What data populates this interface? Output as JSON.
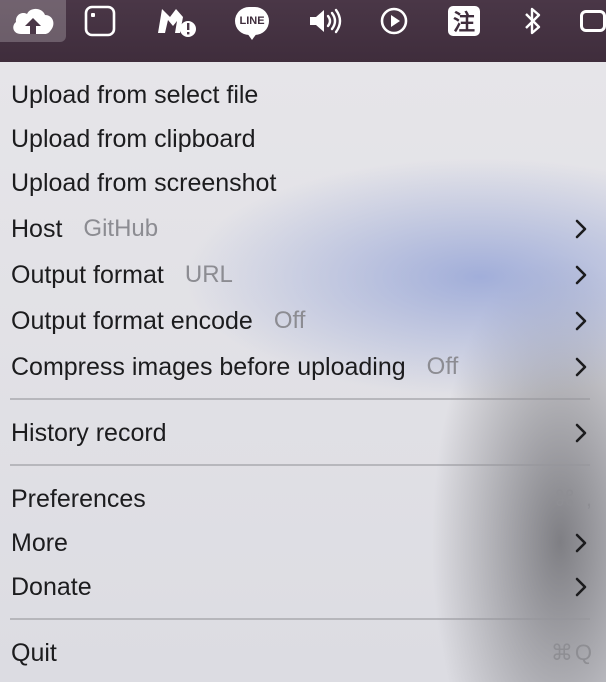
{
  "menubar": {
    "icons": [
      "cloud-upload-icon",
      "square-camera-icon",
      "malwarebytes-icon",
      "line-app-icon",
      "volume-icon",
      "play-circle-icon",
      "zhu-app-icon",
      "bluetooth-icon",
      "battery-icon"
    ],
    "line_label": "LINE",
    "zhu_label": "注"
  },
  "menu": {
    "upload_file": "Upload from select file",
    "upload_clipboard": "Upload from clipboard",
    "upload_screenshot": "Upload from screenshot",
    "host": {
      "label": "Host",
      "value": "GitHub"
    },
    "output_format": {
      "label": "Output format",
      "value": "URL"
    },
    "output_encode": {
      "label": "Output format encode",
      "value": "Off"
    },
    "compress": {
      "label": "Compress images before uploading",
      "value": "Off"
    },
    "history": "History record",
    "preferences": {
      "label": "Preferences",
      "shortcut": "⌘ ,"
    },
    "more": "More",
    "donate": "Donate",
    "quit": {
      "label": "Quit",
      "shortcut": "⌘Q"
    }
  }
}
